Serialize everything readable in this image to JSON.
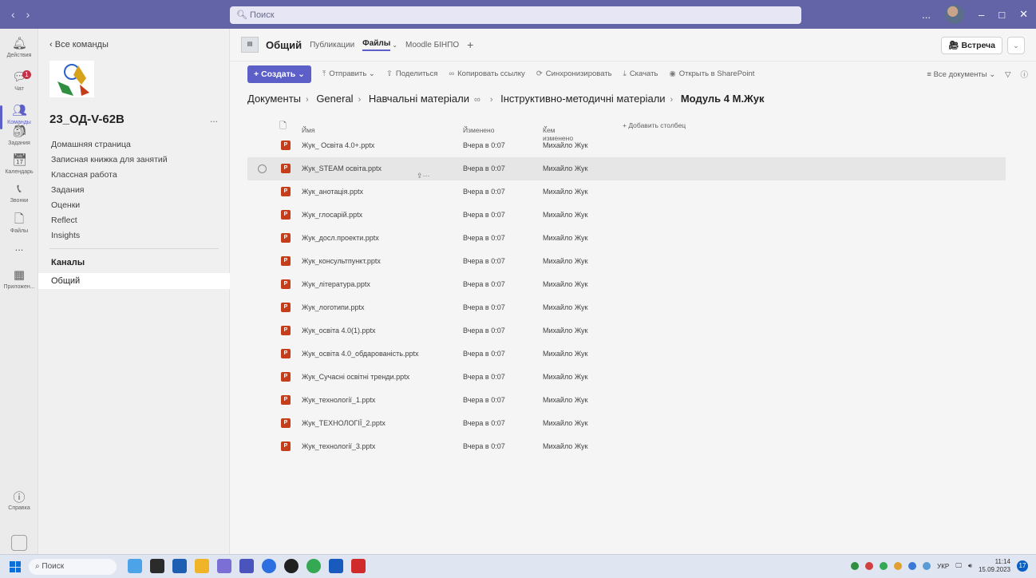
{
  "titlebar": {
    "search_placeholder": "Поиск",
    "more": "...",
    "minimize": "–",
    "maximize": "□",
    "close": "✕"
  },
  "rail": {
    "items": [
      {
        "label": "Действия"
      },
      {
        "label": "Чат",
        "badge": "1"
      },
      {
        "label": "Команды"
      },
      {
        "label": "Задания"
      },
      {
        "label": "Календарь"
      },
      {
        "label": "Звонки"
      },
      {
        "label": "Файлы"
      },
      {
        "label": "..."
      },
      {
        "label": "Приложен..."
      }
    ],
    "help": "Справка"
  },
  "team": {
    "back": "Все команды",
    "logo_text": "2023 НТК ПРОФЕСІЙНО-ТЕХНІЧНА ОСВІТА",
    "name": "23_ОД-V-62В",
    "more": "...",
    "nav": [
      "Домашняя страница",
      "Записная книжка для занятий",
      "Классная работа",
      "Задания",
      "Оценки",
      "Reflect",
      "Insights"
    ],
    "channels_header": "Каналы",
    "channel": "Общий"
  },
  "main": {
    "channel_title": "Общий",
    "tabs": [
      "Публикации",
      "Файлы",
      "Moodle БІНПО"
    ],
    "add_tab": "+",
    "meet_label": "Встреча",
    "commands": {
      "create": "Создать",
      "send": "Отправить",
      "share": "Поделиться",
      "copy_link": "Копировать ссылку",
      "sync": "Синхронизировать",
      "download": "Скачать",
      "open_sharepoint": "Открыть в SharePoint",
      "all_docs": "Все документы"
    },
    "breadcrumb": [
      "Документы",
      "General",
      "Навчальні матеріали",
      "Інструктивно-методичні матеріали",
      "Модуль 4 М.Жук"
    ],
    "columns": {
      "name": "Имя",
      "modified": "Изменено",
      "modified_by": "Кем изменено",
      "add_column": "+ Добавить столбец"
    },
    "files": [
      {
        "name": "Жук_ Освіта 4.0+.pptx",
        "modified": "Вчера в 0:07",
        "by": "Михайло Жук"
      },
      {
        "name": "Жук_STEAM освіта.pptx",
        "modified": "Вчера в 0:07",
        "by": "Михайло Жук"
      },
      {
        "name": "Жук_анотація.pptx",
        "modified": "Вчера в 0:07",
        "by": "Михайло Жук"
      },
      {
        "name": "Жук_глосарій.pptx",
        "modified": "Вчера в 0:07",
        "by": "Михайло Жук"
      },
      {
        "name": "Жук_досл.проекти.pptx",
        "modified": "Вчера в 0:07",
        "by": "Михайло Жук"
      },
      {
        "name": "Жук_консультпункт.pptx",
        "modified": "Вчера в 0:07",
        "by": "Михайло Жук"
      },
      {
        "name": "Жук_література.pptx",
        "modified": "Вчера в 0:07",
        "by": "Михайло Жук"
      },
      {
        "name": "Жук_логотипи.pptx",
        "modified": "Вчера в 0:07",
        "by": "Михайло Жук"
      },
      {
        "name": "Жук_освіта 4.0(1).pptx",
        "modified": "Вчера в 0:07",
        "by": "Михайло Жук"
      },
      {
        "name": "Жук_освіта 4.0_обдарованість.pptx",
        "modified": "Вчера в 0:07",
        "by": "Михайло Жук"
      },
      {
        "name": "Жук_Сучасні освітні тренди.pptx",
        "modified": "Вчера в 0:07",
        "by": "Михайло Жук"
      },
      {
        "name": "Жук_технології_1.pptx",
        "modified": "Вчера в 0:07",
        "by": "Михайло Жук"
      },
      {
        "name": "Жук_ТЕХНОЛОГІЇ_2.pptx",
        "modified": "Вчера в 0:07",
        "by": "Михайло Жук"
      },
      {
        "name": "Жук_технології_3.pptx",
        "modified": "Вчера в 0:07",
        "by": "Михайло Жук"
      }
    ]
  },
  "taskbar": {
    "search": "Поиск",
    "lang": "УКР",
    "time": "11:14",
    "date": "15.09.2023",
    "notifications": "17"
  },
  "colors": {
    "accent": "#5b5fc7",
    "titlebar": "#6264a7",
    "ppt": "#c43e1c"
  }
}
